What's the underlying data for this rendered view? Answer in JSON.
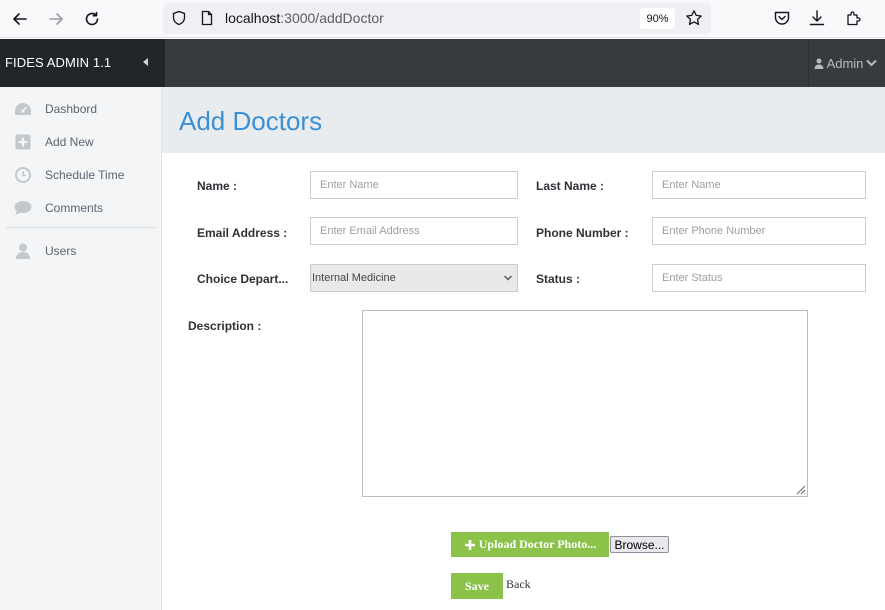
{
  "browser": {
    "url_host": "localhost",
    "url_path": ":3000/addDoctor",
    "zoom": "90%"
  },
  "app": {
    "brand": "FIDES ADMIN 1.1",
    "user_label": "Admin"
  },
  "sidebar": {
    "items": [
      {
        "label": "Dashbord",
        "icon": "dashboard-gauge-icon"
      },
      {
        "label": "Add New",
        "icon": "plus-square-icon"
      },
      {
        "label": "Schedule Time",
        "icon": "clock-icon"
      },
      {
        "label": "Comments",
        "icon": "comment-bubble-icon"
      },
      {
        "label": "Users",
        "icon": "user-icon"
      }
    ]
  },
  "page": {
    "title": "Add Doctors"
  },
  "form": {
    "name_label": "Name :",
    "name_placeholder": "Enter Name",
    "last_name_label": "Last Name :",
    "last_name_placeholder": "Enter Name",
    "email_label": "Email Address :",
    "email_placeholder": "Enter Email Address",
    "phone_label": "Phone Number :",
    "phone_placeholder": "Enter Phone Number",
    "department_label": "Choice Depart...",
    "department_value": "Internal Medicine",
    "status_label": "Status :",
    "status_placeholder": "Enter Status",
    "description_label": "Description :",
    "upload_label": "Upload Doctor Photo...",
    "browse_label": "Browse...",
    "save_label": "Save",
    "back_label": "Back"
  },
  "colors": {
    "accent": "#3b8fd4",
    "button": "#8bc34a",
    "sidebar_bg": "#f4f5f6",
    "topbar": "#363b40"
  }
}
